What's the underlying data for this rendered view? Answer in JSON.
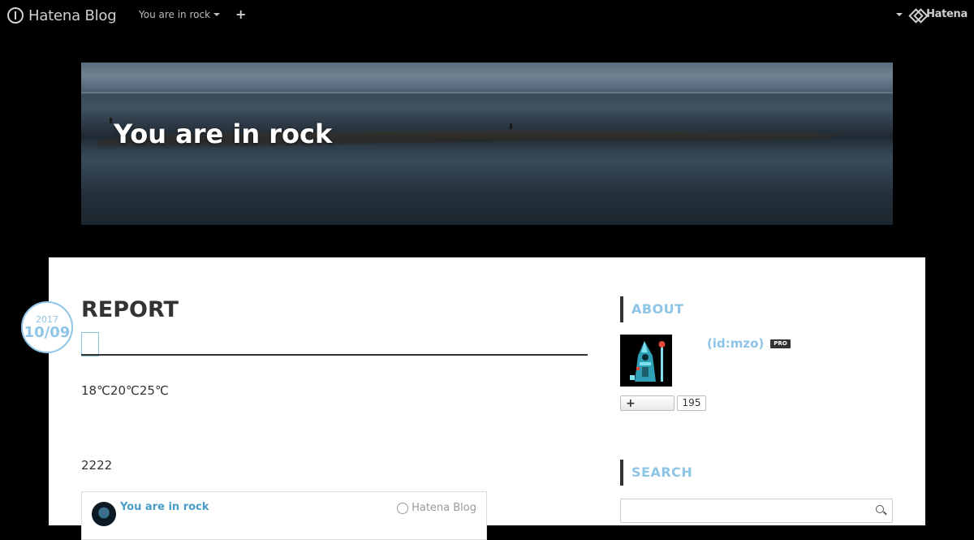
{
  "topbar": {
    "logo_text": "Hatena Blog",
    "blog_menu_label": "You are in rock",
    "add_label": "+",
    "brand_label": "Hatena"
  },
  "header": {
    "blog_title": "You are in rock"
  },
  "entry": {
    "date_year": "2017",
    "date_md": "10/09",
    "title": "REPORT",
    "paragraph_1": "18℃20℃25℃",
    "paragraph_2": "2222",
    "embed": {
      "title": "You are in rock",
      "brand": "Hatena Blog"
    }
  },
  "sidebar": {
    "about_label": "ABOUT",
    "profile_id": "(id:mzo)",
    "pro_badge": "PRO",
    "follow_button_label": "+",
    "follow_count": "195",
    "search_label": "SEARCH",
    "search_placeholder": ""
  },
  "colors": {
    "accent": "#8ec5e6",
    "text": "#333333",
    "background": "#000000",
    "card": "#ffffff"
  }
}
